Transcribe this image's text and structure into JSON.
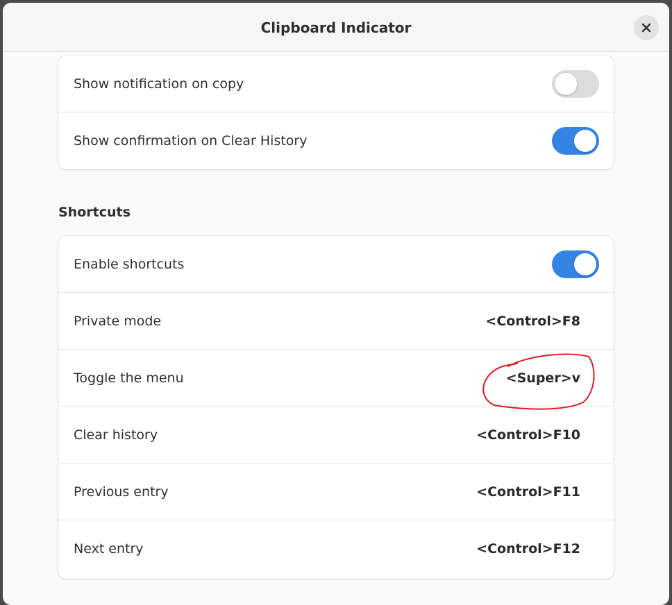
{
  "window": {
    "title": "Clipboard Indicator"
  },
  "notifications": {
    "rows": [
      {
        "label": "Show notification on copy",
        "enabled": false
      },
      {
        "label": "Show confirmation on Clear History",
        "enabled": true
      }
    ]
  },
  "shortcuts": {
    "section_title": "Shortcuts",
    "enable_label": "Enable shortcuts",
    "enable_state": true,
    "rows": [
      {
        "label": "Private mode",
        "accel": "<Control>F8"
      },
      {
        "label": "Toggle the menu",
        "accel": "<Super>v"
      },
      {
        "label": "Clear history",
        "accel": "<Control>F10"
      },
      {
        "label": "Previous entry",
        "accel": "<Control>F11"
      },
      {
        "label": "Next entry",
        "accel": "<Control>F12"
      }
    ]
  },
  "colors": {
    "accent": "#3584e4",
    "annotation": "#e01b24"
  },
  "icons": {
    "close": "close-icon"
  }
}
